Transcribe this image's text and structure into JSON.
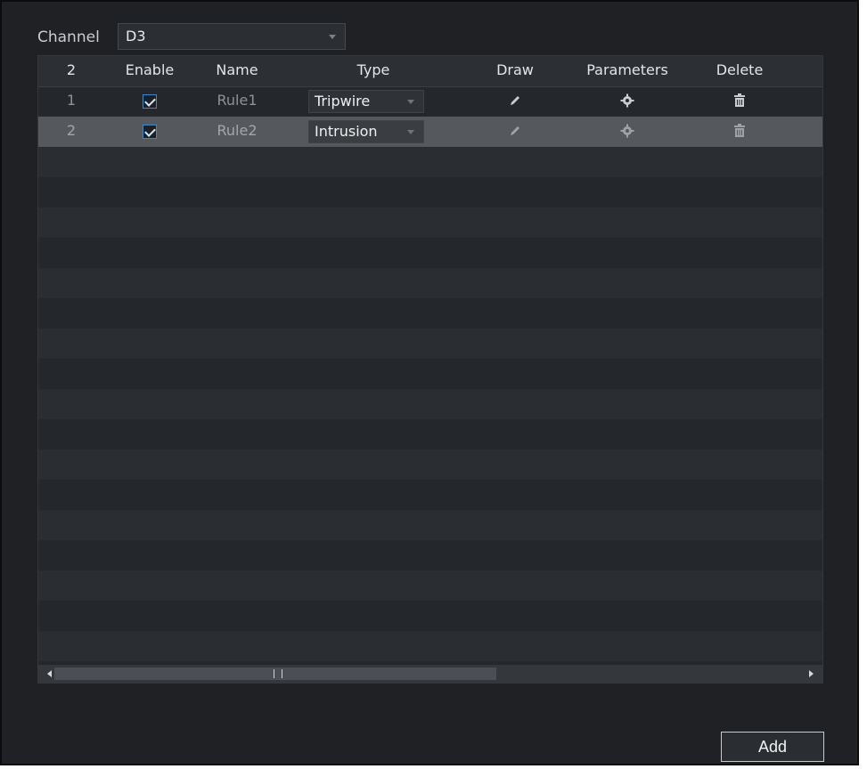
{
  "channel": {
    "label": "Channel",
    "value": "D3"
  },
  "table": {
    "columns": [
      "2",
      "Enable",
      "Name",
      "Type",
      "Draw",
      "Parameters",
      "Delete"
    ],
    "rows": [
      {
        "index": "1",
        "enabled": true,
        "name": "Rule1",
        "type": "Tripwire"
      },
      {
        "index": "2",
        "enabled": true,
        "name": "Rule2",
        "type": "Intrusion"
      }
    ]
  },
  "icons": {
    "draw": "pencil-icon",
    "parameters": "gear-icon",
    "delete": "trash-icon"
  },
  "add_button": "Add",
  "colors": {
    "accent": "#3b87c7",
    "selected_row": "#55585d",
    "panel": "#1f2125"
  }
}
